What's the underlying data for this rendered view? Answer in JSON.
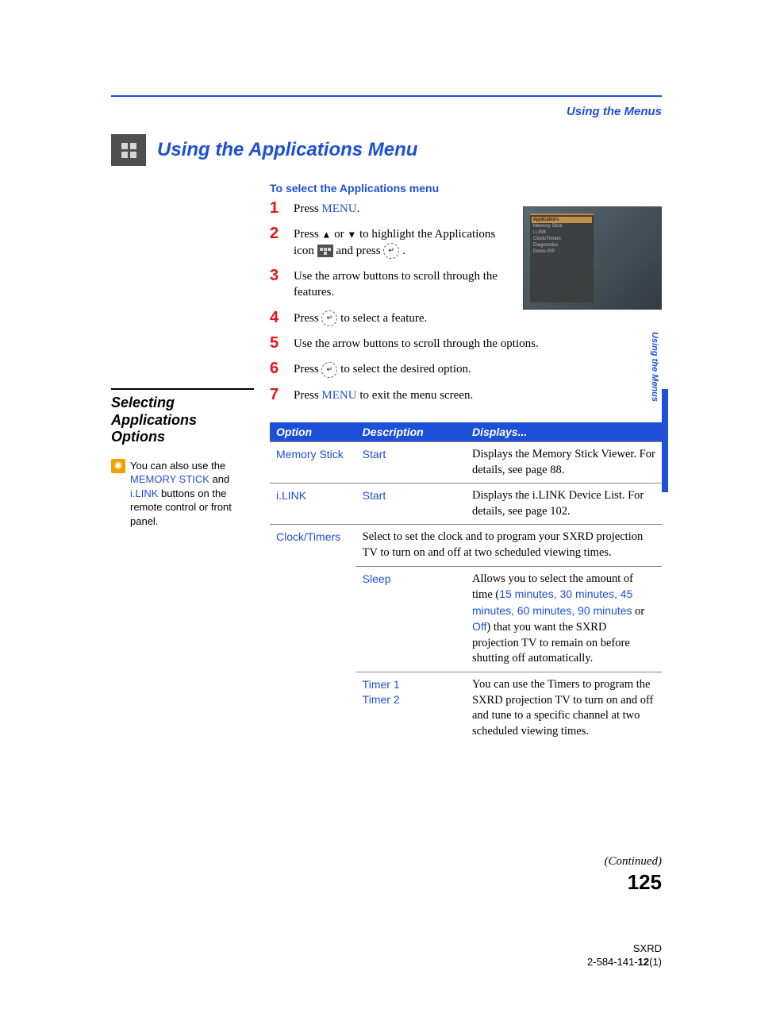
{
  "header": {
    "chapter": "Using the Menus"
  },
  "title": "Using the Applications Menu",
  "subhead": "To select the Applications menu",
  "steps": {
    "1_pre": "Press ",
    "1_link": "MENU",
    "1_post": ".",
    "2_pre": "Press ",
    "2_mid": " to highlight the Applications icon ",
    "2_post": " and press ",
    "2_end": " .",
    "3": "Use the arrow buttons to scroll through the features.",
    "4_pre": "Press ",
    "4_post": " to select a feature.",
    "5": "Use the arrow buttons to scroll through the options.",
    "6_pre": "Press ",
    "6_post": " to select the desired option.",
    "7_pre": "Press ",
    "7_link": "MENU",
    "7_post": " to exit the menu screen."
  },
  "sidebar": {
    "heading": "Selecting Applications Options",
    "tip_pre": "You can also use the ",
    "tip_l1": "MEMORY STICK",
    "tip_mid1": " and ",
    "tip_l2": "i.LINK",
    "tip_post": " buttons on the remote control or front panel."
  },
  "side_tab": "Using the Menus",
  "screenshot_menu": {
    "title": "Applications",
    "i1": "Memory Stick",
    "i2": "i.LINK",
    "i3": "Clock/Timers",
    "i4": "Diagnostics",
    "i5": "Demo PIP"
  },
  "table": {
    "h1": "Option",
    "h2": "Description",
    "h3": "Displays...",
    "r1": {
      "opt": "Memory Stick",
      "desc": "Start",
      "disp": "Displays the Memory Stick Viewer. For details, see page 88."
    },
    "r2": {
      "opt": "i.LINK",
      "desc": "Start",
      "disp": "Displays the i.LINK Device List. For details, see page 102."
    },
    "r3": {
      "opt": "Clock/Timers",
      "desc": "Select to set the clock and to program your SXRD projection TV to turn on and off at two scheduled viewing times."
    },
    "r3a": {
      "desc": "Sleep",
      "disp_pre": "Allows you to select the amount of time (",
      "disp_times": "15 minutes, 30 minutes, 45 minutes, 60 minutes, 90 minutes",
      "disp_or": " or ",
      "disp_off": "Off",
      "disp_post": ") that you want the SXRD projection TV to remain on before shutting off automatically."
    },
    "r3b": {
      "desc1": "Timer 1",
      "desc2": "Timer 2",
      "disp": "You can use the Timers to program the SXRD projection TV to turn on and off and tune to a specific channel at two scheduled viewing times."
    }
  },
  "continued": "(Continued)",
  "page_number": "125",
  "footer": {
    "l1": "SXRD",
    "l2_pre": "2-584-141-",
    "l2_bold": "12",
    "l2_post": "(1)"
  },
  "or_word": " or "
}
